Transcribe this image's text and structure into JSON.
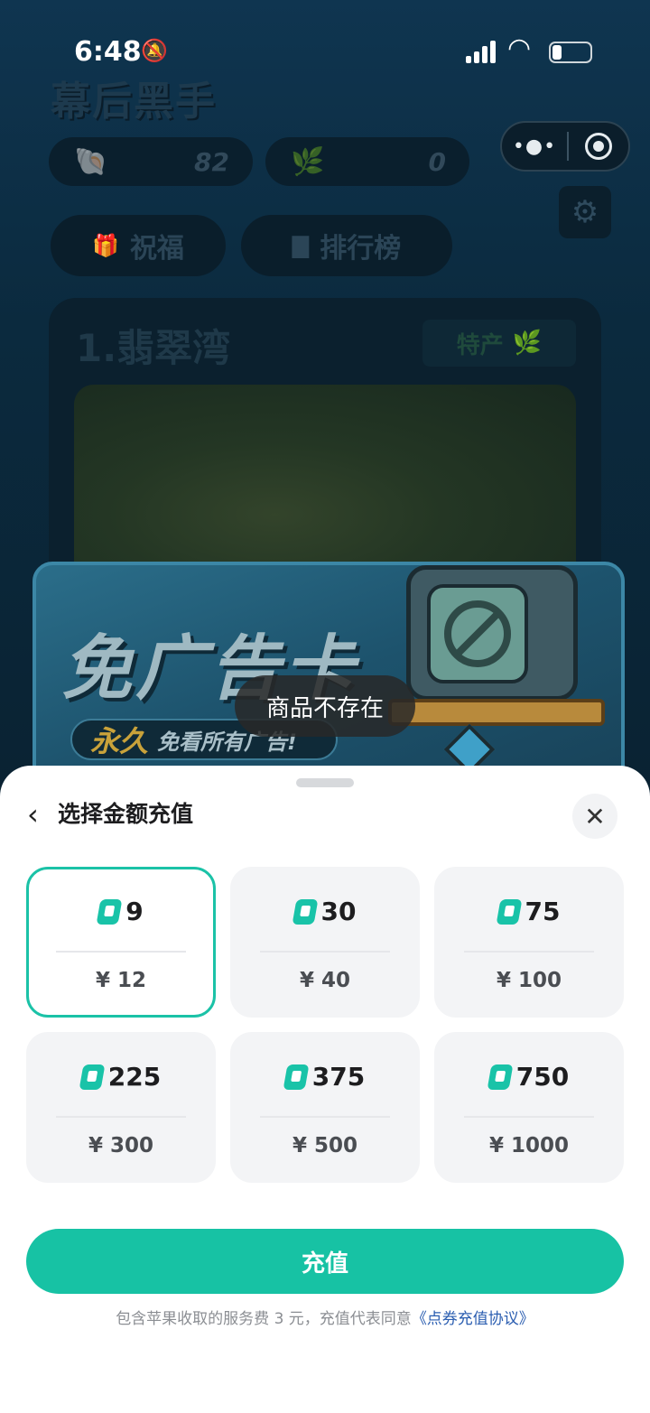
{
  "status_bar": {
    "time": "6:48"
  },
  "game": {
    "title": "幕后黑手",
    "shells": "82",
    "seaweed": "0",
    "blessing_label": "祝福",
    "leaderboard_label": "排行榜",
    "level_name": "1.翡翠湾",
    "specialty_label": "特产",
    "banner_title": "免广告卡",
    "banner_sub_a": "永久",
    "banner_sub_b": "免看所有广告!"
  },
  "toast": "商品不存在",
  "sheet": {
    "title": "选择金额充值",
    "options": [
      {
        "amount": "9",
        "price": "¥ 12",
        "selected": true
      },
      {
        "amount": "30",
        "price": "¥ 40"
      },
      {
        "amount": "75",
        "price": "¥ 100"
      },
      {
        "amount": "225",
        "price": "¥ 300"
      },
      {
        "amount": "375",
        "price": "¥ 500"
      },
      {
        "amount": "750",
        "price": "¥ 1000"
      }
    ],
    "pay_label": "充值",
    "footnote_text": "包含苹果收取的服务费 3 元，充值代表同意",
    "footnote_link": "《点券充值协议》"
  },
  "colors": {
    "accent": "#17c2a4",
    "link": "#2a5db0"
  },
  "icons": [
    "back-icon",
    "close-icon",
    "coupon-icon",
    "gear-icon",
    "more-icon",
    "target-icon"
  ]
}
